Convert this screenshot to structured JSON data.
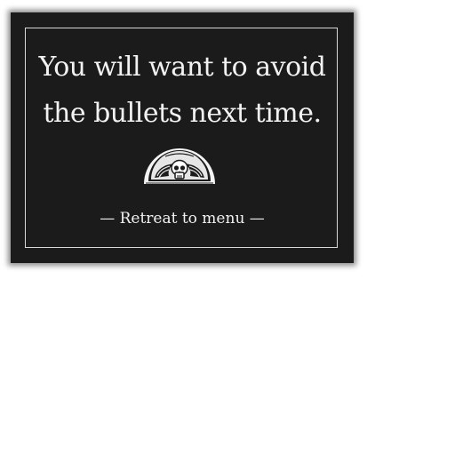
{
  "dialog": {
    "message_line1": "You will want to avoid",
    "message_line2": "the bullets next time.",
    "emblem_icon": "winged-skull-icon",
    "retreat_label": "— Retreat to menu —"
  },
  "colors": {
    "card_background": "#1b1b1b",
    "text": "#f2f2f2",
    "frame_border": "#d8d8d8"
  }
}
